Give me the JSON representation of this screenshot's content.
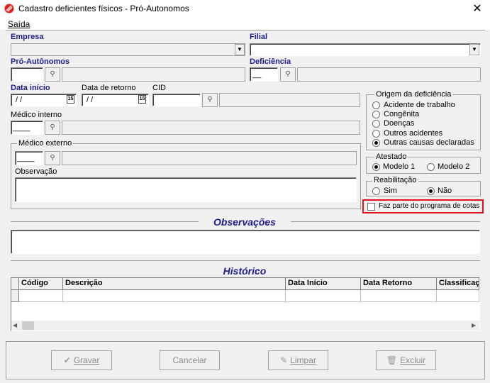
{
  "window": {
    "title": "Cadastro deficientes físicos - Pró-Autonomos",
    "close_glyph": "✕"
  },
  "menu": {
    "items": [
      {
        "label": "Saída"
      }
    ]
  },
  "form": {
    "empresa_label": "Empresa",
    "filial_label": "Filial",
    "pro_autonomos_label": "Pró-Autônomos",
    "deficiencia_label": "Deficiência",
    "deficiencia_value": "__",
    "data_inicio_label": "Data início",
    "data_inicio_value": "/ /",
    "data_retorno_label": "Data de retorno",
    "data_retorno_value": "/ /",
    "cid_label": "CID",
    "medico_interno_label": "Médico interno",
    "medico_interno_value": "____",
    "medico_externo_label": "Médico externo",
    "medico_externo_value": "____",
    "observacao_label": "Observação",
    "calendar_glyph": "15"
  },
  "origem": {
    "title": "Origem da deficiência",
    "options": [
      {
        "label": "Acidente de trabalho"
      },
      {
        "label": "Congênita"
      },
      {
        "label": "Doenças"
      },
      {
        "label": "Outros acidentes"
      },
      {
        "label": "Outras causas declaradas"
      }
    ],
    "selected": "Outras causas declaradas"
  },
  "atestado": {
    "title": "Atestado",
    "options": [
      {
        "label": "Modelo 1"
      },
      {
        "label": "Modelo 2"
      }
    ],
    "selected": "Modelo 1"
  },
  "reabilitacao": {
    "title": "Reabilitação",
    "options": [
      {
        "label": "Sim"
      },
      {
        "label": "Não"
      }
    ],
    "selected": "Não"
  },
  "cotas": {
    "label": "Faz parte do programa de cotas",
    "checked": false,
    "highlight_color": "#e0141e"
  },
  "observacoes": {
    "heading": "Observações"
  },
  "historico": {
    "heading": "Histórico",
    "columns": [
      "Código",
      "Descrição",
      "Data Início",
      "Data Retorno",
      "Classificaç"
    ]
  },
  "buttons": {
    "gravar": "Gravar",
    "cancelar": "Cancelar",
    "limpar": "Limpar",
    "excluir": "Excluir"
  },
  "colors": {
    "label_blue": "#1c1c8c",
    "background": "#f0f0f0"
  }
}
